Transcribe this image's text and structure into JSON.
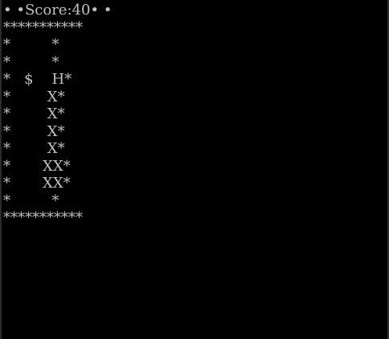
{
  "window": {
    "background": "#000000",
    "text_color": "#c0c0c0"
  },
  "game": {
    "score_line": "• •Score:40• •",
    "board": [
      "***********",
      "*         *",
      "*         *",
      "*   $    H*",
      "*        X*",
      "*        X*",
      "*        X*",
      "*        X*",
      "*       XX*",
      "*       XX*",
      "*         *",
      "***********"
    ]
  }
}
